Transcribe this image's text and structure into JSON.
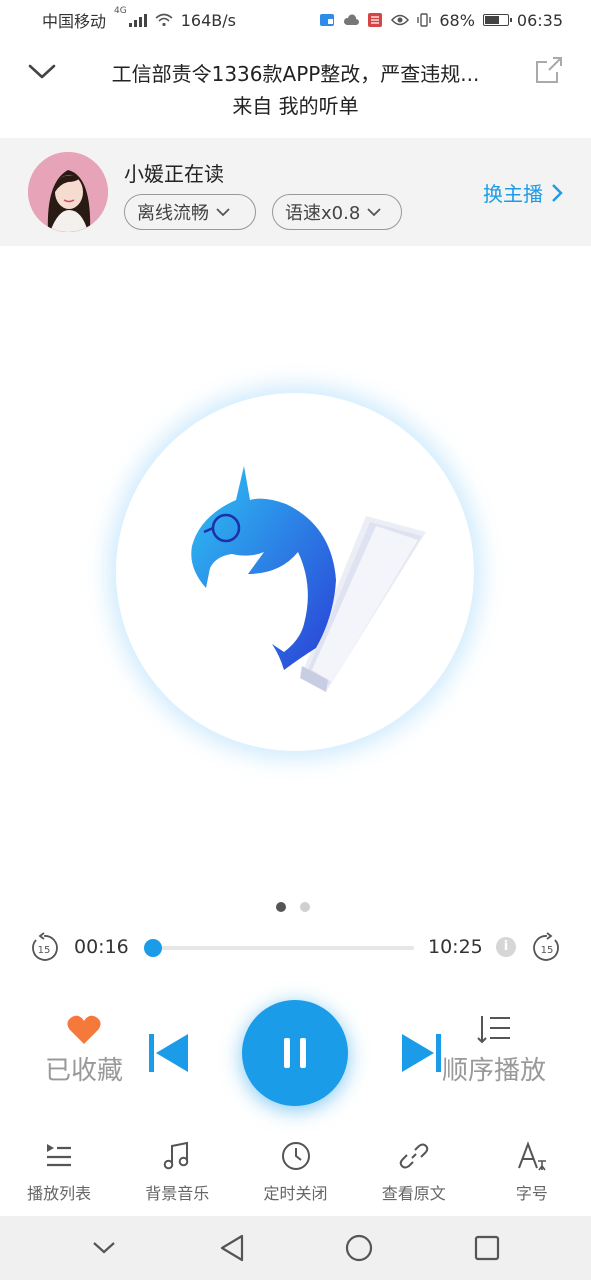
{
  "status_bar": {
    "carrier": "中国移动",
    "network": "4G",
    "speed": "164B/s",
    "battery": "68%",
    "battery_level": 0.68,
    "time": "06:35"
  },
  "header": {
    "title": "工信部责令1336款APP整改，严查违规...",
    "subtitle": "来自 我的听单"
  },
  "anchor": {
    "reader": "小媛正在读",
    "mode": "离线流畅",
    "speed": "语速x0.8",
    "switch_label": "换主播"
  },
  "pager": {
    "count": 2,
    "active_index": 0
  },
  "progress": {
    "current": "00:16",
    "total": "10:25",
    "fraction": 0.026,
    "rewind_seconds": "15",
    "forward_seconds": "15"
  },
  "controls": {
    "favorite_label": "已收藏",
    "order_label": "顺序播放"
  },
  "toolbar": {
    "items": [
      {
        "label": "播放列表",
        "icon": "playlist-icon"
      },
      {
        "label": "背景音乐",
        "icon": "music-note-icon"
      },
      {
        "label": "定时关闭",
        "icon": "clock-icon"
      },
      {
        "label": "查看原文",
        "icon": "link-icon"
      },
      {
        "label": "字号",
        "icon": "font-size-icon"
      }
    ]
  },
  "colors": {
    "accent": "#1a9ce8",
    "favorite": "#f5793a",
    "anchor_bar_bg": "#f3f3f3"
  }
}
